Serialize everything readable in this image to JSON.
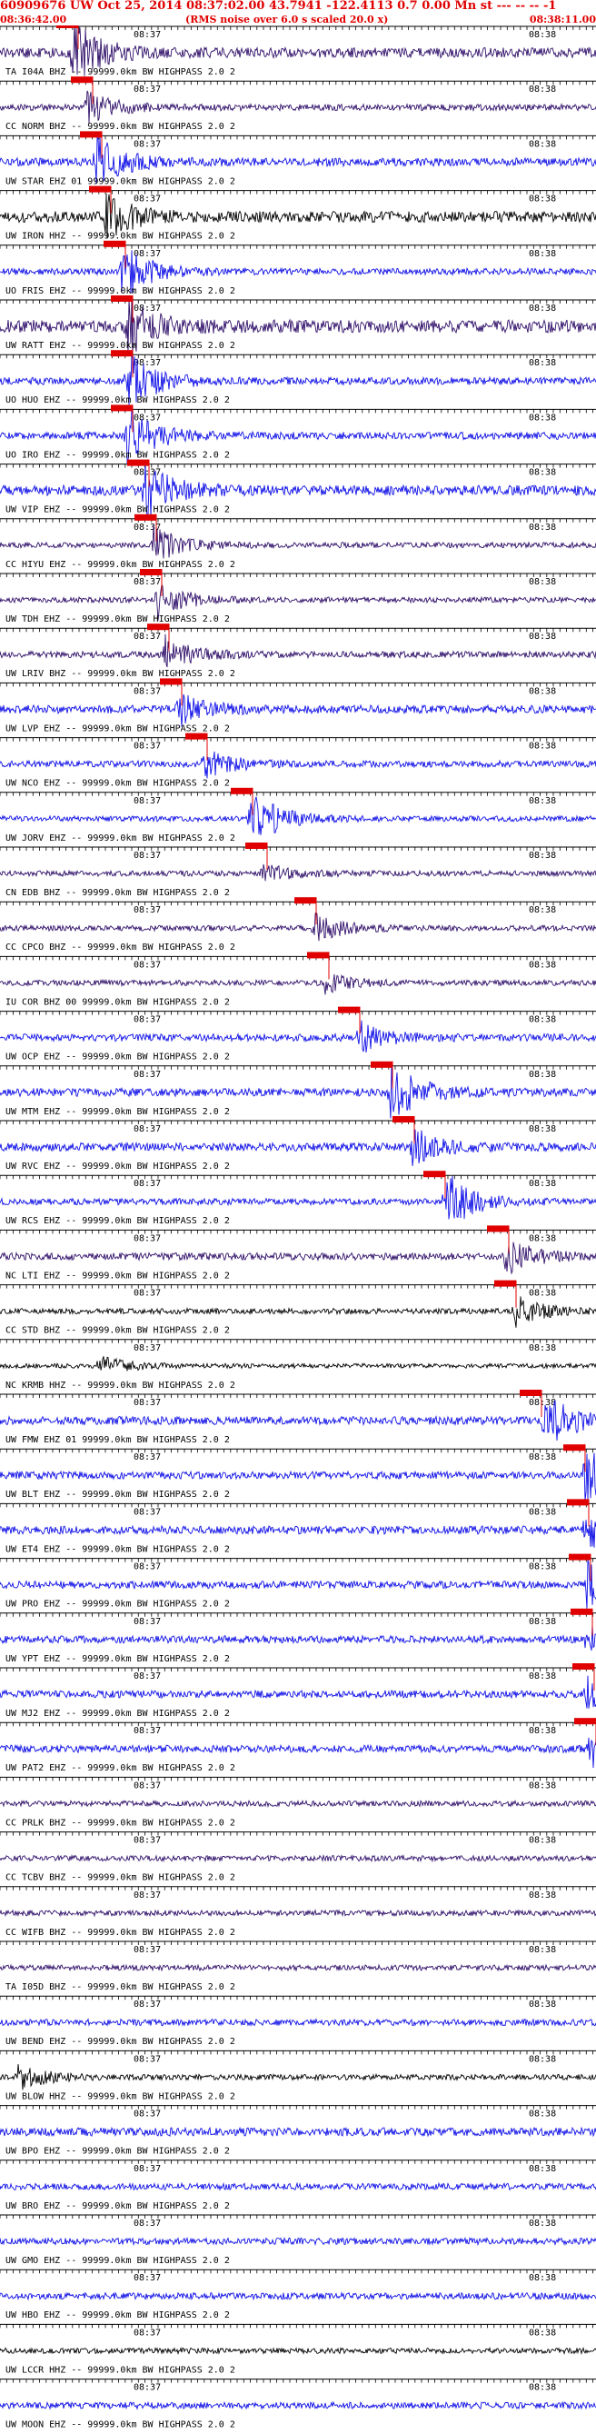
{
  "header": {
    "title": "60909676 UW Oct 25, 2014 08:37:02.00   43.7941 -122.4113  0.7 0.00 Mn st --- -- -- -1",
    "start_time": "08:36:42.00",
    "note": "(RMS noise over 6.0 s scaled 20.0 x)",
    "end_time": "08:38:11.00"
  },
  "chart_data": {
    "type": "seismogram",
    "time_axis": {
      "start": "08:36:42.00",
      "end": "08:38:11.00",
      "tick_labels": [
        "08:37",
        "08:38"
      ],
      "minor_tick_interval_s": 1
    },
    "colors": {
      "blue": "#1010e8",
      "purple": "#30106a",
      "black": "#000000",
      "pick": "#e00000",
      "grid": "#000000"
    },
    "traces": [
      {
        "label": "TA I04A BHZ -- 99999.0km BW  HIGHPASS  2.0  2",
        "color": "purple",
        "amp": 0.55,
        "burst_t": 80,
        "burst_amp": 1.0,
        "pick_t": 74
      },
      {
        "label": "CC NORM BHZ -- 99999.0km BW  HIGHPASS  2.0  2",
        "color": "purple",
        "amp": 0.35,
        "burst_t": 96,
        "burst_amp": 0.5,
        "pick_t": 90
      },
      {
        "label": "UW STAR EHZ 01 99999.0km BW  HIGHPASS  2.0  2",
        "color": "blue",
        "amp": 0.45,
        "burst_t": 106,
        "burst_amp": 0.8,
        "pick_t": 100
      },
      {
        "label": "UW IRON HHZ -- 99999.0km BW  HIGHPASS  2.0  2",
        "color": "black",
        "amp": 0.6,
        "burst_t": 116,
        "burst_amp": 0.7,
        "pick_t": 110
      },
      {
        "label": "UO FRIS EHZ -- 99999.0km BW  HIGHPASS  2.0  2",
        "color": "blue",
        "amp": 0.35,
        "burst_t": 134,
        "burst_amp": 0.9,
        "pick_t": 126
      },
      {
        "label": "UW RATT EHZ -- 99999.0km BW  HIGHPASS  2.0  2",
        "color": "purple",
        "amp": 0.7,
        "burst_t": 140,
        "burst_amp": 0.9,
        "pick_t": 134
      },
      {
        "label": "UO HUO EHZ -- 99999.0km BW  HIGHPASS  2.0  2",
        "color": "blue",
        "amp": 0.4,
        "burst_t": 140,
        "burst_amp": 1.0,
        "pick_t": 134
      },
      {
        "label": "UO IRO EHZ -- 99999.0km BW  HIGHPASS  2.0  2",
        "color": "blue",
        "amp": 0.4,
        "burst_t": 140,
        "burst_amp": 1.0,
        "pick_t": 134
      },
      {
        "label": "UW VIP EHZ -- 99999.0km BW  HIGHPASS  2.0  2",
        "color": "blue",
        "amp": 0.55,
        "burst_t": 160,
        "burst_amp": 0.9,
        "pick_t": 152
      },
      {
        "label": "CC HIYU EHZ -- 99999.0km BW  HIGHPASS  2.0  2",
        "color": "purple",
        "amp": 0.3,
        "burst_t": 168,
        "burst_amp": 0.6,
        "pick_t": 160
      },
      {
        "label": "UW TDH EHZ -- 99999.0km BW  HIGHPASS  2.0  2",
        "color": "purple",
        "amp": 0.3,
        "burst_t": 174,
        "burst_amp": 0.6,
        "pick_t": 166
      },
      {
        "label": "UW LRIV BHZ -- 99999.0km BW  HIGHPASS  2.0  2",
        "color": "purple",
        "amp": 0.35,
        "burst_t": 182,
        "burst_amp": 0.6,
        "pick_t": 174
      },
      {
        "label": "UW LVP EHZ -- 99999.0km BW  HIGHPASS  2.0  2",
        "color": "blue",
        "amp": 0.45,
        "burst_t": 196,
        "burst_amp": 0.5,
        "pick_t": 188
      },
      {
        "label": "UW NCO EHZ -- 99999.0km BW  HIGHPASS  2.0  2",
        "color": "blue",
        "amp": 0.35,
        "burst_t": 224,
        "burst_amp": 0.5,
        "pick_t": 216
      },
      {
        "label": "UW JORV EHZ -- 99999.0km BW  HIGHPASS  2.0  2",
        "color": "blue",
        "amp": 0.3,
        "burst_t": 276,
        "burst_amp": 1.0,
        "pick_t": 266
      },
      {
        "label": "CN EDB BHZ -- 99999.0km BW  HIGHPASS  2.0  2",
        "color": "purple",
        "amp": 0.3,
        "burst_t": 290,
        "burst_amp": 0.3,
        "pick_t": 282
      },
      {
        "label": "CC CPCO BHZ -- 99999.0km BW  HIGHPASS  2.0  2",
        "color": "purple",
        "amp": 0.3,
        "burst_t": 346,
        "burst_amp": 0.5,
        "pick_t": 336
      },
      {
        "label": "IU COR BHZ 00 99999.0km BW  HIGHPASS  2.0  2",
        "color": "purple",
        "amp": 0.3,
        "burst_t": 358,
        "burst_amp": 0.3,
        "pick_t": 350
      },
      {
        "label": "UW OCP EHZ -- 99999.0km BW  HIGHPASS  2.0  2",
        "color": "blue",
        "amp": 0.4,
        "burst_t": 396,
        "burst_amp": 0.5,
        "pick_t": 384
      },
      {
        "label": "UW MTM EHZ -- 99999.0km BW  HIGHPASS  2.0  2",
        "color": "blue",
        "amp": 0.45,
        "burst_t": 430,
        "burst_amp": 1.0,
        "pick_t": 420
      },
      {
        "label": "UW RVC EHZ -- 99999.0km BW  HIGHPASS  2.0  2",
        "color": "blue",
        "amp": 0.45,
        "burst_t": 454,
        "burst_amp": 0.6,
        "pick_t": 444
      },
      {
        "label": "UW RCS EHZ -- 99999.0km BW  HIGHPASS  2.0  2",
        "color": "blue",
        "amp": 0.35,
        "burst_t": 490,
        "burst_amp": 1.0,
        "pick_t": 478
      },
      {
        "label": "NC LTI EHZ -- 99999.0km BW  HIGHPASS  2.0  2",
        "color": "purple",
        "amp": 0.4,
        "burst_t": 556,
        "burst_amp": 0.6,
        "pick_t": 548
      },
      {
        "label": "CC STD BHZ -- 99999.0km BW  HIGHPASS  2.0  2",
        "color": "black",
        "amp": 0.3,
        "burst_t": 566,
        "burst_amp": 0.5,
        "pick_t": 556
      },
      {
        "label": "NC KRMB HHZ -- 99999.0km BW  HIGHPASS  2.0  2",
        "color": "black",
        "amp": 0.25,
        "burst_t": 110,
        "burst_amp": 0.3,
        "pick_t": null
      },
      {
        "label": "UW FMW EHZ 01 99999.0km BW  HIGHPASS  2.0  2",
        "color": "blue",
        "amp": 0.45,
        "burst_t": 600,
        "burst_amp": 0.9,
        "pick_t": 584
      },
      {
        "label": "UW BLT EHZ -- 99999.0km BW  HIGHPASS  2.0  2",
        "color": "blue",
        "amp": 0.4,
        "burst_t": 644,
        "burst_amp": 0.9,
        "pick_t": 632
      },
      {
        "label": "UW ET4 EHZ -- 99999.0km BW  HIGHPASS  2.0  2",
        "color": "blue",
        "amp": 0.45,
        "burst_t": 644,
        "burst_amp": 0.8,
        "pick_t": 636
      },
      {
        "label": "UW PRO EHZ -- 99999.0km BW  HIGHPASS  2.0  2",
        "color": "blue",
        "amp": 0.4,
        "burst_t": 646,
        "burst_amp": 0.7,
        "pick_t": 638
      },
      {
        "label": "UW YPT EHZ -- 99999.0km BW  HIGHPASS  2.0  2",
        "color": "blue",
        "amp": 0.4,
        "burst_t": 646,
        "burst_amp": 0.6,
        "pick_t": 640
      },
      {
        "label": "UW MJ2 EHZ -- 99999.0km BW  HIGHPASS  2.0  2",
        "color": "blue",
        "amp": 0.4,
        "burst_t": 646,
        "burst_amp": 0.6,
        "pick_t": 642
      },
      {
        "label": "UW PAT2 EHZ -- 99999.0km BW  HIGHPASS  2.0  2",
        "color": "blue",
        "amp": 0.4,
        "burst_t": 648,
        "burst_amp": 0.6,
        "pick_t": 644
      },
      {
        "label": "CC PRLK BHZ -- 99999.0km BW  HIGHPASS  2.0  2",
        "color": "purple",
        "amp": 0.3,
        "burst_t": null,
        "burst_amp": 0,
        "pick_t": null
      },
      {
        "label": "CC TCBV BHZ -- 99999.0km BW  HIGHPASS  2.0  2",
        "color": "purple",
        "amp": 0.3,
        "burst_t": null,
        "burst_amp": 0,
        "pick_t": null
      },
      {
        "label": "CC WIFB BHZ -- 99999.0km BW  HIGHPASS  2.0  2",
        "color": "purple",
        "amp": 0.3,
        "burst_t": null,
        "burst_amp": 0,
        "pick_t": null
      },
      {
        "label": "TA I05D BHZ -- 99999.0km BW  HIGHPASS  2.0  2",
        "color": "purple",
        "amp": 0.3,
        "burst_t": null,
        "burst_amp": 0,
        "pick_t": null
      },
      {
        "label": "UW BEND EHZ -- 99999.0km BW  HIGHPASS  2.0  2",
        "color": "blue",
        "amp": 0.35,
        "burst_t": null,
        "burst_amp": 0,
        "pick_t": null
      },
      {
        "label": "UW BLOW HHZ -- 99999.0km BW  HIGHPASS  2.0  2",
        "color": "black",
        "amp": 0.3,
        "burst_t": 20,
        "burst_amp": 0.4,
        "pick_t": null
      },
      {
        "label": "UW BPO EHZ -- 99999.0km BW  HIGHPASS  2.0  2",
        "color": "blue",
        "amp": 0.45,
        "burst_t": null,
        "burst_amp": 0,
        "pick_t": null
      },
      {
        "label": "UW BRO EHZ -- 99999.0km BW  HIGHPASS  2.0  2",
        "color": "blue",
        "amp": 0.35,
        "burst_t": null,
        "burst_amp": 0,
        "pick_t": null
      },
      {
        "label": "UW GMO EHZ -- 99999.0km BW  HIGHPASS  2.0  2",
        "color": "blue",
        "amp": 0.35,
        "burst_t": null,
        "burst_amp": 0,
        "pick_t": null
      },
      {
        "label": "UW HBO EHZ -- 99999.0km BW  HIGHPASS  2.0  2",
        "color": "blue",
        "amp": 0.35,
        "burst_t": null,
        "burst_amp": 0,
        "pick_t": null
      },
      {
        "label": "UW LCCR HHZ -- 99999.0km BW  HIGHPASS  2.0  2",
        "color": "black",
        "amp": 0.3,
        "burst_t": null,
        "burst_amp": 0,
        "pick_t": null
      },
      {
        "label": "UW MOON EHZ -- 99999.0km BW  HIGHPASS  2.0  2",
        "color": "blue",
        "amp": 0.35,
        "burst_t": null,
        "burst_amp": 0,
        "pick_t": null
      }
    ]
  }
}
